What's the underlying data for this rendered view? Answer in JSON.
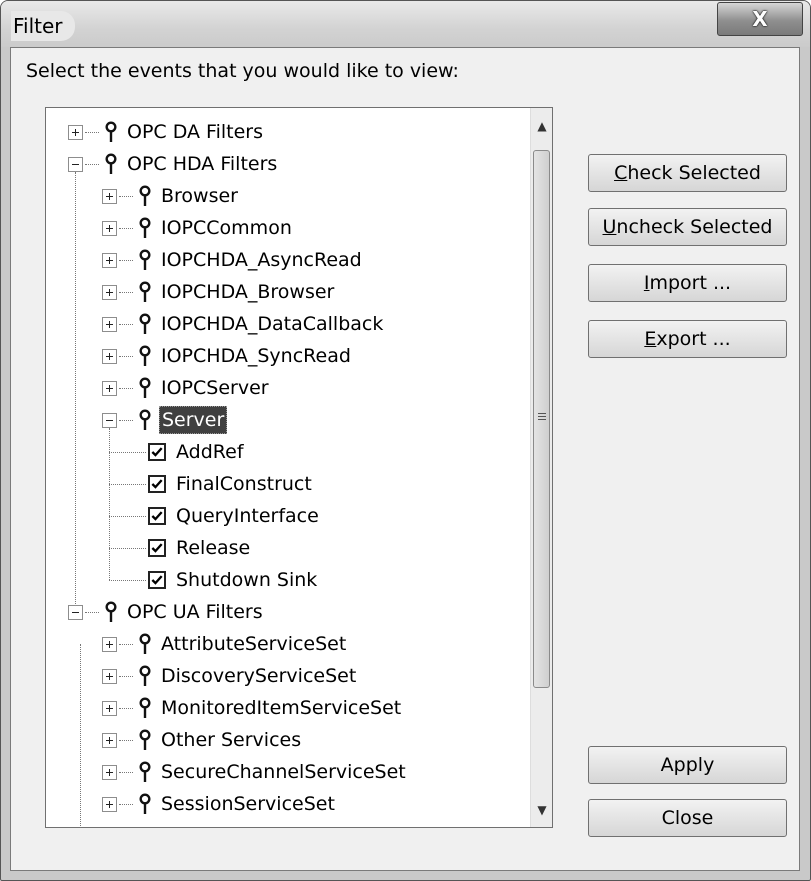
{
  "window": {
    "title": "Filter",
    "close_glyph": "X"
  },
  "prompt": "Select the events that you would like to view:",
  "tree": [
    {
      "label": "OPC DA Filters",
      "level": 0,
      "kind": "group",
      "expanded": false
    },
    {
      "label": "OPC HDA Filters",
      "level": 0,
      "kind": "group",
      "expanded": true
    },
    {
      "label": "Browser",
      "level": 1,
      "kind": "group",
      "expanded": false
    },
    {
      "label": "IOPCCommon",
      "level": 1,
      "kind": "group",
      "expanded": false
    },
    {
      "label": "IOPCHDA_AsyncRead",
      "level": 1,
      "kind": "group",
      "expanded": false
    },
    {
      "label": "IOPCHDA_Browser",
      "level": 1,
      "kind": "group",
      "expanded": false
    },
    {
      "label": "IOPCHDA_DataCallback",
      "level": 1,
      "kind": "group",
      "expanded": false
    },
    {
      "label": "IOPCHDA_SyncRead",
      "level": 1,
      "kind": "group",
      "expanded": false
    },
    {
      "label": "IOPCServer",
      "level": 1,
      "kind": "group",
      "expanded": false
    },
    {
      "label": "Server",
      "level": 1,
      "kind": "group",
      "expanded": true,
      "selected": true
    },
    {
      "label": "AddRef",
      "level": 2,
      "kind": "check",
      "checked": true
    },
    {
      "label": "FinalConstruct",
      "level": 2,
      "kind": "check",
      "checked": true
    },
    {
      "label": "QueryInterface",
      "level": 2,
      "kind": "check",
      "checked": true
    },
    {
      "label": "Release",
      "level": 2,
      "kind": "check",
      "checked": true
    },
    {
      "label": "Shutdown Sink",
      "level": 2,
      "kind": "check",
      "checked": true
    },
    {
      "label": "OPC UA Filters",
      "level": 0,
      "kind": "group",
      "expanded": true
    },
    {
      "label": "AttributeServiceSet",
      "level": 1,
      "kind": "group",
      "expanded": false
    },
    {
      "label": "DiscoveryServiceSet",
      "level": 1,
      "kind": "group",
      "expanded": false
    },
    {
      "label": "MonitoredItemServiceSet",
      "level": 1,
      "kind": "group",
      "expanded": false
    },
    {
      "label": "Other Services",
      "level": 1,
      "kind": "group",
      "expanded": false
    },
    {
      "label": "SecureChannelServiceSet",
      "level": 1,
      "kind": "group",
      "expanded": false
    },
    {
      "label": "SessionServiceSet",
      "level": 1,
      "kind": "group",
      "expanded": false
    }
  ],
  "buttons": {
    "check_selected": {
      "mnemonic": "C",
      "rest": "heck Selected"
    },
    "uncheck_selected": {
      "mnemonic": "U",
      "rest": "ncheck Selected"
    },
    "import": {
      "mnemonic": "I",
      "rest": "mport ..."
    },
    "export": {
      "mnemonic": "E",
      "rest": "xport ..."
    },
    "apply": "Apply",
    "close": "Close"
  },
  "scrollbar": {
    "up_glyph": "▲",
    "down_glyph": "▼"
  }
}
